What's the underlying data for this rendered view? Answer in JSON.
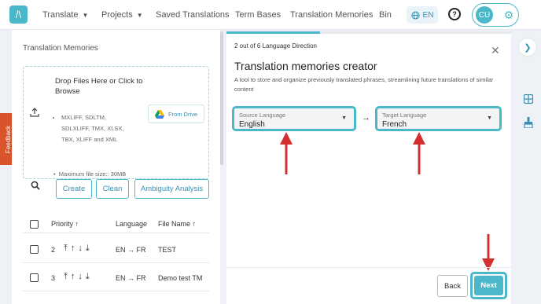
{
  "nav": {
    "translate": "Translate",
    "projects": "Projects",
    "saved_translations": "Saved Translations",
    "term_bases": "Term Bases",
    "translation_memories": "Translation Memories",
    "bin": "Bin",
    "language": "EN",
    "avatar": "CU"
  },
  "left": {
    "title": "Translation Memories",
    "drop_text": "Drop Files Here or Click to Browse",
    "formats": [
      "MXLIFF, SDLTM, SDLXLIFF, TMX, XLSX, TBX, XLIFF and XML"
    ],
    "max_size": "Maximum file size:: 30MB",
    "from_drive": "From Drive",
    "buttons": {
      "create": "Create",
      "clean": "Clean",
      "ambiguity": "Ambiguity Analysis"
    },
    "table": {
      "headers": {
        "priority": "Priority",
        "language": "Language",
        "file_name": "File Name"
      },
      "rows": [
        {
          "priority": "2",
          "language": "EN → FR",
          "file_name": "TEST"
        },
        {
          "priority": "3",
          "language": "EN → FR",
          "file_name": "Demo test TM"
        }
      ]
    }
  },
  "dialog": {
    "step": "2 out of 6 Language Direction",
    "progress": 0.33,
    "title": "Translation memories creator",
    "description": "A tool to store and organize previously translated phrases, streamlining future translations of similar content",
    "source_label": "Source Language",
    "source_value": "English",
    "target_label": "Target Language",
    "target_value": "French",
    "back": "Back",
    "next": "Next"
  },
  "feedback": "Feedback",
  "colors": {
    "accent": "#4bb8c9",
    "annotation": "#d32f2f",
    "feedback": "#d9532b"
  }
}
